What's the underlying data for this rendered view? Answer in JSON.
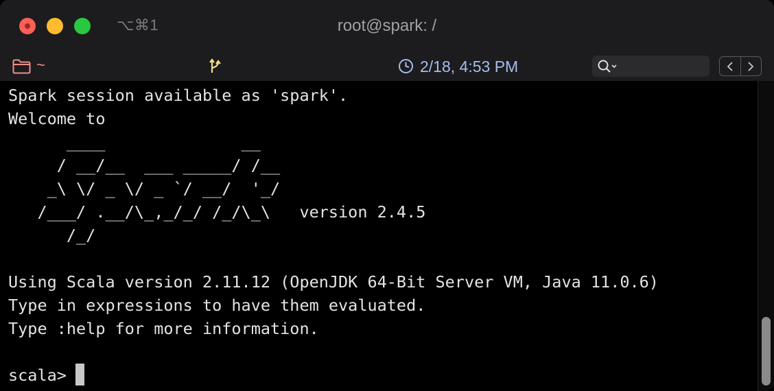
{
  "window": {
    "title": "root@spark: /",
    "shortcut": "⌥⌘1"
  },
  "statusbar": {
    "directory": "~",
    "time": "2/18, 4:53 PM",
    "search_placeholder": ""
  },
  "terminal": {
    "lines": [
      "Spark session available as 'spark'.",
      "Welcome to",
      "      ____              __",
      "     / __/__  ___ _____/ /__",
      "    _\\ \\/ _ \\/ _ `/ __/  '_/",
      "   /___/ .__/\\_,_/_/ /_/\\_\\   version 2.4.5",
      "      /_/",
      "",
      "Using Scala version 2.11.12 (OpenJDK 64-Bit Server VM, Java 11.0.6)",
      "Type in expressions to have them evaluated.",
      "Type :help for more information.",
      "",
      "scala> "
    ]
  },
  "colors": {
    "directory": "#ef8f8a",
    "time": "#a6bdf0",
    "git_icon": "#f3e08a",
    "close": "#fe5f57",
    "minimize": "#febc2e",
    "maximize": "#28c840"
  },
  "icons": {
    "folder": "folder-icon",
    "git": "git-branch-icon",
    "clock": "clock-icon",
    "search": "search-icon",
    "prev": "chevron-left-icon",
    "next": "chevron-right-icon"
  }
}
